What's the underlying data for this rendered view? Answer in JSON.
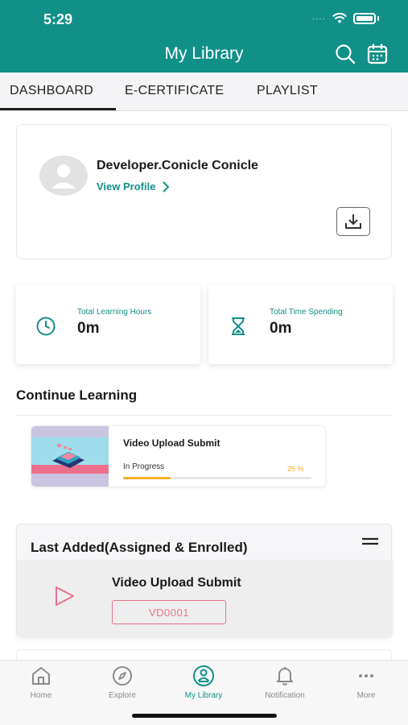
{
  "status_bar": {
    "time": "5:29",
    "signal_dots": "····"
  },
  "header": {
    "title": "My Library",
    "search_icon": "search-icon",
    "calendar_icon": "calendar-icon"
  },
  "tabs": [
    {
      "label": "DASHBOARD",
      "active": true
    },
    {
      "label": "E-CERTIFICATE",
      "active": false
    },
    {
      "label": "PLAYLIST",
      "active": false
    }
  ],
  "profile": {
    "name": "Developer.Conicle Conicle",
    "view_profile_label": "View Profile",
    "download_icon": "download-icon"
  },
  "stats": [
    {
      "label": "Total Learning Hours",
      "value": "0m",
      "icon": "clock-icon"
    },
    {
      "label": "Total Time Spending",
      "value": "0m",
      "icon": "hourglass-icon"
    }
  ],
  "continue_learning": {
    "title": "Continue Learning",
    "course": {
      "title": "Video Upload Submit",
      "status": "In Progress",
      "percent_label": "25 %",
      "progress": 0.25
    }
  },
  "last_added": {
    "title": "Last Added(Assigned & Enrolled)",
    "item": {
      "title": "Video Upload Submit",
      "code": "VD0001",
      "icon": "play-icon"
    }
  },
  "bottom_nav": [
    {
      "label": "Home",
      "icon": "home-icon",
      "active": false
    },
    {
      "label": "Explore",
      "icon": "compass-icon",
      "active": false
    },
    {
      "label": "My Library",
      "icon": "my-library-icon",
      "active": true
    },
    {
      "label": "Notification",
      "icon": "bell-icon",
      "active": false
    },
    {
      "label": "More",
      "icon": "more-icon",
      "active": false
    }
  ],
  "colors": {
    "primary": "#119088",
    "accent_pink": "#e9738a",
    "progress": "#f3b12a"
  }
}
